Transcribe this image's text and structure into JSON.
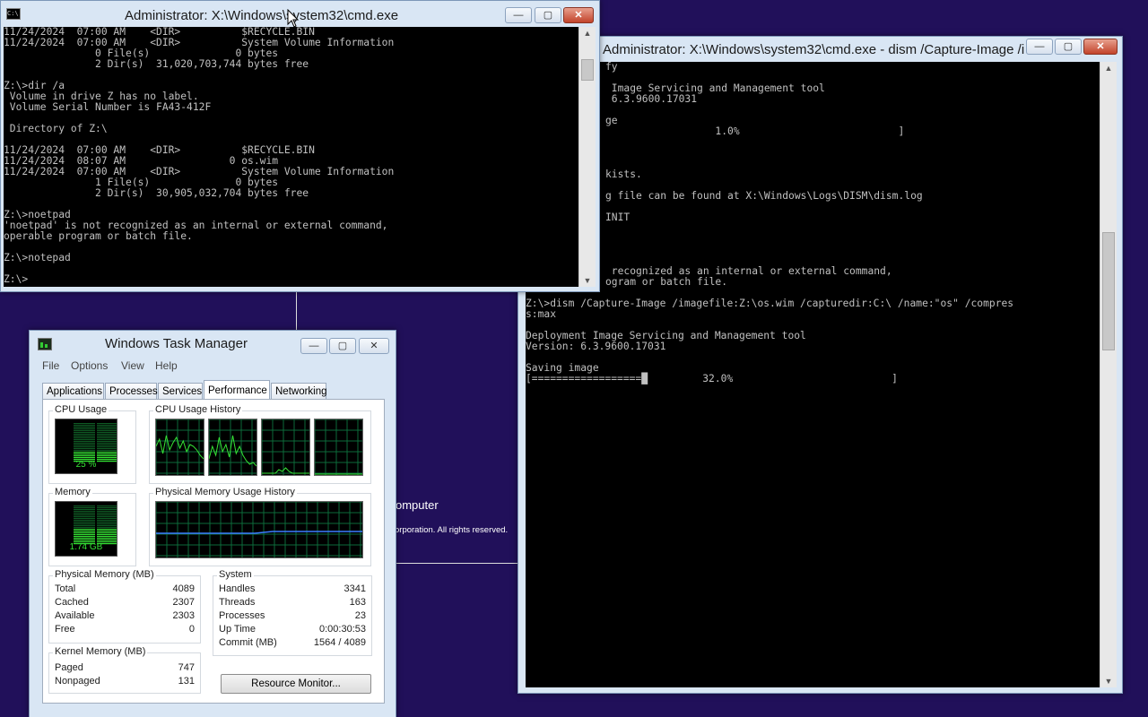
{
  "colors": {
    "desktop": "#21105a",
    "console_bg": "#000000",
    "console_fg": "#c0c0c0",
    "meter_green": "#35e335",
    "graph_grid": "#0d6a3a",
    "memory_line": "#3b7cff"
  },
  "background": {
    "setup_fragment": "omputer",
    "copyright_fragment": "orporation. All rights reserved."
  },
  "cmd1": {
    "title": "Administrator: X:\\Windows\\system32\\cmd.exe",
    "icon": "cmd-icon",
    "buttons": {
      "minimize": "—",
      "maximize": "▢",
      "close": "✕"
    },
    "lines": [
      "11/24/2024  07:00 AM    <DIR>          $RECYCLE.BIN",
      "11/24/2024  07:00 AM    <DIR>          System Volume Information",
      "               0 File(s)              0 bytes",
      "               2 Dir(s)  31,020,703,744 bytes free",
      "",
      "Z:\\>dir /a",
      " Volume in drive Z has no label.",
      " Volume Serial Number is FA43-412F",
      "",
      " Directory of Z:\\",
      "",
      "11/24/2024  07:00 AM    <DIR>          $RECYCLE.BIN",
      "11/24/2024  08:07 AM                 0 os.wim",
      "11/24/2024  07:00 AM    <DIR>          System Volume Information",
      "               1 File(s)              0 bytes",
      "               2 Dir(s)  30,905,032,704 bytes free",
      "",
      "Z:\\>noetpad",
      "'noetpad' is not recognized as an internal or external command,",
      "operable program or batch file.",
      "",
      "Z:\\>notepad",
      "",
      "Z:\\>"
    ]
  },
  "cmd2": {
    "title": "Administrator: X:\\Windows\\system32\\cmd.exe - dism  /Capture-Image /i...",
    "buttons": {
      "minimize": "—",
      "maximize": "▢",
      "close": "✕"
    },
    "lines": [
      "fy",
      "",
      " Image Servicing and Management tool",
      " 6.3.9600.17031",
      "",
      "ge",
      "                  1.0%                          ]",
      "",
      "",
      "",
      "kists.",
      "",
      "g file can be found at X:\\Windows\\Logs\\DISM\\dism.log",
      "",
      "INIT",
      "",
      "",
      "",
      "",
      " recognized as an internal or external command,",
      "ogram or batch file.",
      "",
      "",
      "",
      "",
      "",
      "",
      "",
      "",
      "",
      "",
      "",
      "",
      "",
      "",
      "",
      "",
      "",
      "",
      "",
      "",
      ""
    ],
    "full_lines": [
      "Z:\\>dism /Capture-Image /imagefile:Z:\\os.wim /capturedir:C:\\ /name:\"os\" /compres",
      "s:max",
      "",
      "Deployment Image Servicing and Management tool",
      "Version: 6.3.9600.17031",
      "",
      "Saving image",
      "[==================█         32.0%                          ]"
    ]
  },
  "taskmgr": {
    "title": "Windows Task Manager",
    "buttons": {
      "minimize": "—",
      "maximize": "▢",
      "close": "✕"
    },
    "menu": [
      "File",
      "Options",
      "View",
      "Help"
    ],
    "tabs": [
      "Applications",
      "Processes",
      "Services",
      "Performance",
      "Networking"
    ],
    "active_tab": "Performance",
    "cpu_usage_label": "CPU Usage",
    "cpu_usage_value": "25 %",
    "cpu_usage_fraction": 0.25,
    "cpu_history_label": "CPU Usage History",
    "memory_label": "Memory",
    "memory_value": "1.74 GB",
    "memory_fraction": 0.43,
    "memory_history_label": "Physical Memory Usage History",
    "physical_memory": {
      "label": "Physical Memory (MB)",
      "rows": [
        {
          "k": "Total",
          "v": "4089"
        },
        {
          "k": "Cached",
          "v": "2307"
        },
        {
          "k": "Available",
          "v": "2303"
        },
        {
          "k": "Free",
          "v": "0"
        }
      ]
    },
    "system": {
      "label": "System",
      "rows": [
        {
          "k": "Handles",
          "v": "3341"
        },
        {
          "k": "Threads",
          "v": "163"
        },
        {
          "k": "Processes",
          "v": "23"
        },
        {
          "k": "Up Time",
          "v": "0:00:30:53"
        },
        {
          "k": "Commit (MB)",
          "v": "1564 / 4089"
        }
      ]
    },
    "kernel_memory": {
      "label": "Kernel Memory (MB)",
      "rows": [
        {
          "k": "Paged",
          "v": "747"
        },
        {
          "k": "Nonpaged",
          "v": "131"
        }
      ]
    },
    "resource_monitor_label": "Resource Monitor..."
  }
}
